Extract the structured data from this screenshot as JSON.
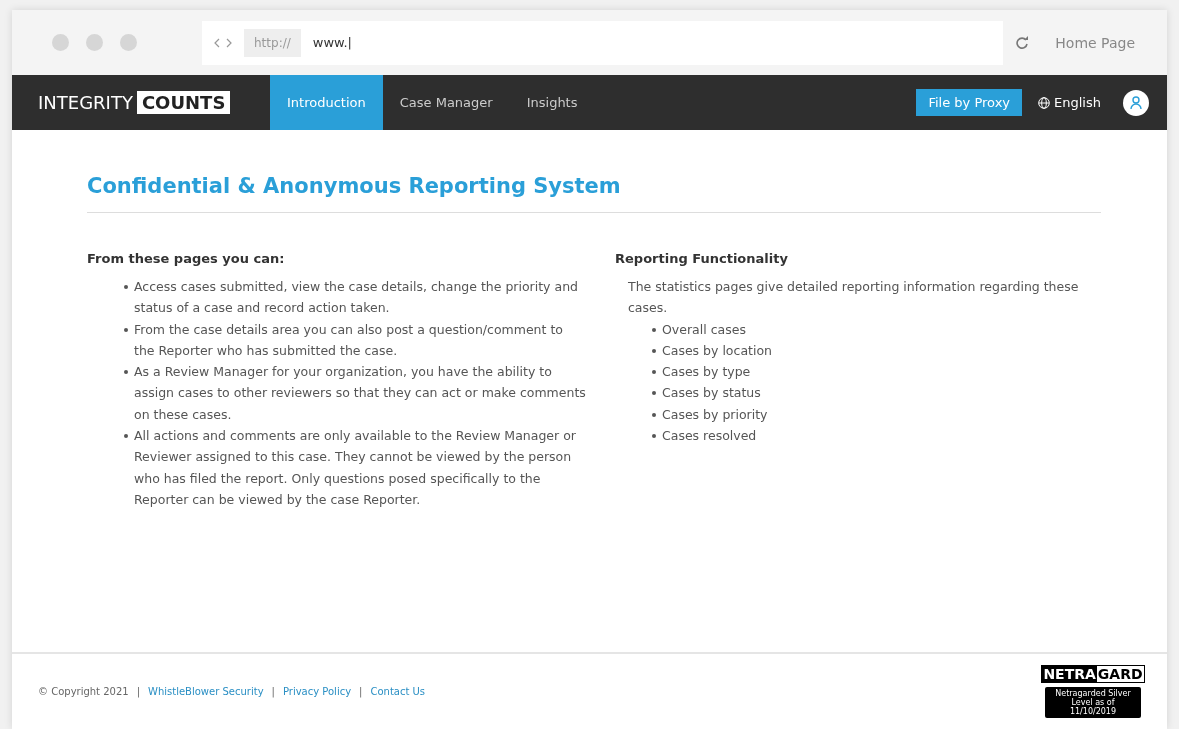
{
  "browser": {
    "scheme": "http://",
    "url": "www.|",
    "home": "Home Page"
  },
  "nav": {
    "logo_light": "INTEGRITY",
    "logo_bold": "COUNTS",
    "tabs": [
      {
        "label": "Introduction",
        "selected": true
      },
      {
        "label": "Case Manager",
        "selected": false
      },
      {
        "label": "Insights",
        "selected": false
      }
    ],
    "proxy_button": "File by Proxy",
    "language": "English"
  },
  "title": "Confidential & Anonymous Reporting System",
  "left": {
    "heading": "From these pages you can:",
    "items": [
      "Access cases submitted, view the case details, change the priority and status of a case and record action taken.",
      "From the case details area you can also post a question/comment to the Reporter who has submitted the case.",
      "As a Review Manager for your organization, you have the ability to assign cases to other reviewers so that they can act or make comments on these cases.",
      "All actions and comments are only available to the Review Manager or Reviewer assigned to this case. They cannot be viewed by the person who has filed the report. Only questions posed specifically to the Reporter can be viewed by the case Reporter."
    ]
  },
  "right": {
    "heading": "Reporting Functionality",
    "intro": "The statistics pages give detailed reporting information regarding these cases.",
    "items": [
      "Overall cases",
      "Cases by location",
      "Cases by type",
      "Cases by status",
      "Cases by priority",
      "Cases resolved"
    ]
  },
  "footer": {
    "copyright": "© Copyright 2021",
    "links": [
      "WhistleBlower Security",
      "Privacy Policy",
      "Contact Us"
    ],
    "separator": "|"
  },
  "badge": {
    "brand_a": "NETRA",
    "brand_b": "GARD",
    "note": "Netragarded Silver Level as of 11/10/2019"
  }
}
